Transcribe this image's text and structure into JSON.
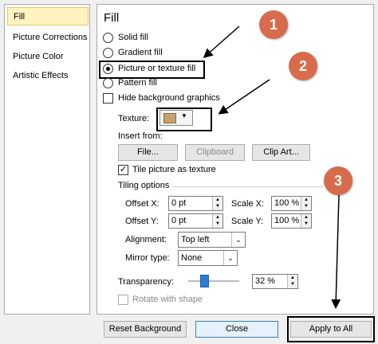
{
  "nav": {
    "items": [
      {
        "label": "Fill",
        "selected": true
      },
      {
        "label": "Picture Corrections",
        "selected": false
      },
      {
        "label": "Picture Color",
        "selected": false
      },
      {
        "label": "Artistic Effects",
        "selected": false
      }
    ]
  },
  "panel": {
    "title": "Fill",
    "fill_options": [
      {
        "label": "Solid fill",
        "checked": false
      },
      {
        "label": "Gradient fill",
        "checked": false
      },
      {
        "label": "Picture or texture fill",
        "checked": true
      },
      {
        "label": "Pattern fill",
        "checked": false
      }
    ],
    "hide_background_label": "Hide background graphics",
    "hide_background_checked": false,
    "texture_label": "Texture:",
    "insert_from_label": "Insert from:",
    "file_button": "File...",
    "clipboard_button": "Clipboard",
    "clipart_button": "Clip Art...",
    "tile_label": "Tile picture as texture",
    "tile_checked": true,
    "tiling_options_label": "Tiling options",
    "offset_x_label": "Offset X:",
    "offset_x_value": "0 pt",
    "offset_y_label": "Offset Y:",
    "offset_y_value": "0 pt",
    "scale_x_label": "Scale X:",
    "scale_x_value": "100 %",
    "scale_y_label": "Scale Y:",
    "scale_y_value": "100 %",
    "alignment_label": "Alignment:",
    "alignment_value": "Top left",
    "mirror_label": "Mirror type:",
    "mirror_value": "None",
    "transparency_label": "Transparency:",
    "transparency_value": "32 %",
    "transparency_fraction": 0.32,
    "rotate_label": "Rotate with shape"
  },
  "footer": {
    "reset_button": "Reset Background",
    "close_button": "Close",
    "apply_all_button": "Apply to All"
  },
  "annotations": {
    "badges": [
      "1",
      "2",
      "3"
    ],
    "badge_color": "#d76b4b"
  }
}
